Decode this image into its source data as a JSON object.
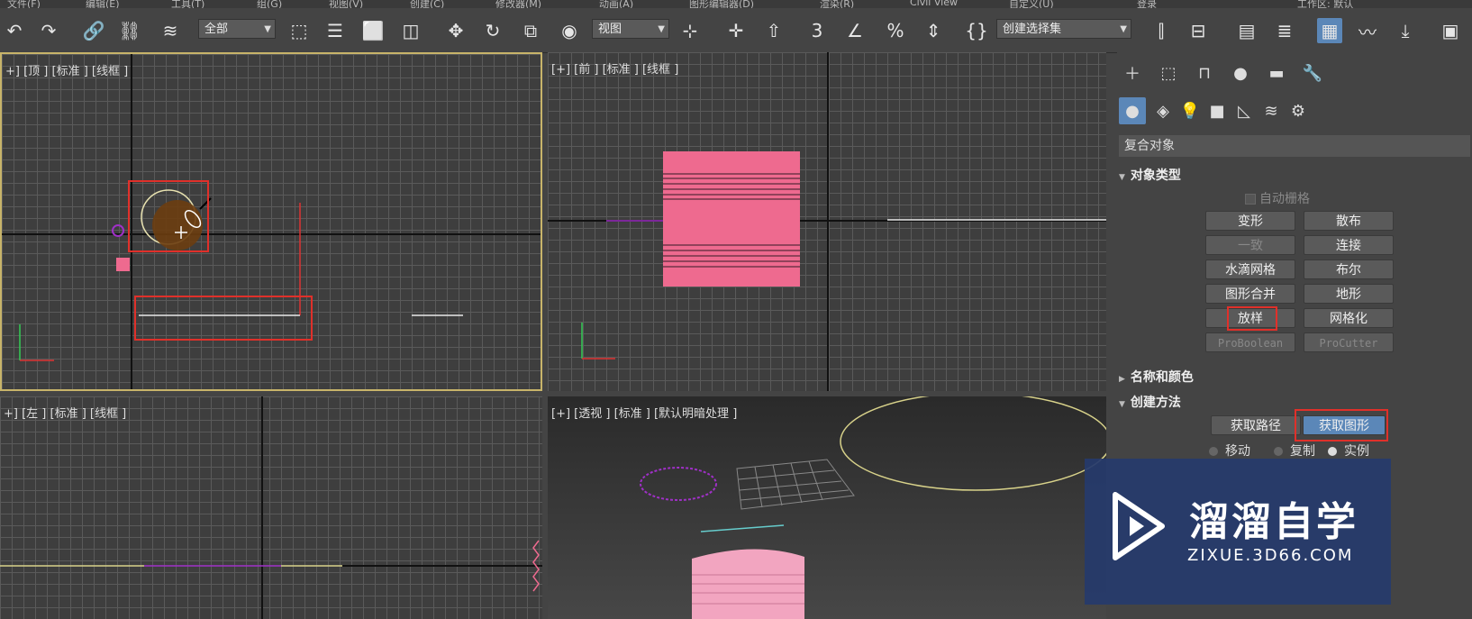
{
  "menubar": {
    "items": [
      "文件(F)",
      "编辑(E)",
      "工具(T)",
      "组(G)",
      "视图(V)",
      "创建(C)",
      "修改器(M)",
      "动画(A)",
      "图形编辑器(D)",
      "渲染(R)",
      "Civil View",
      "自定义(U)"
    ],
    "signin_label": "登录",
    "workspace_label": "工作区: 默认"
  },
  "toolbar": {
    "selection_filter": "全部",
    "ref_coord": "视图",
    "named_selection": "创建选择集",
    "icons": [
      "undo-icon",
      "redo-icon",
      "link-icon",
      "unlink-icon",
      "bind-space-warp-icon",
      "select-object-icon",
      "select-by-name-icon",
      "rect-region-icon",
      "window-crossing-icon",
      "move-icon",
      "rotate-icon",
      "scale-icon",
      "select-and-place-icon",
      "use-pivot-icon",
      "keyboard-shortcut-icon",
      "snap-3-icon",
      "angle-snap-icon",
      "percent-snap-icon",
      "spinner-snap-icon",
      "edit-named-sets-icon",
      "mirror-icon",
      "align-icon",
      "toggle-scene-explorer-icon",
      "toggle-layer-explorer-icon",
      "toggle-ribbon-icon",
      "curve-editor-icon",
      "schematic-view-icon",
      "material-editor-icon"
    ]
  },
  "viewports": {
    "top": {
      "label": "+] [顶 ] [标准 ] [线框 ]"
    },
    "front": {
      "label": "[+] [前 ] [标准 ] [线框 ]"
    },
    "left": {
      "label": "+] [左 ] [标准 ] [线框 ]"
    },
    "persp": {
      "label": "[+] [透视 ] [标准 ] [默认明暗处理 ]"
    }
  },
  "command_panel": {
    "category": "复合对象",
    "rollouts": {
      "object_type": {
        "title": "对象类型",
        "autogrid": "自动栅格",
        "buttons": [
          "变形",
          "散布",
          "一致",
          "连接",
          "水滴网格",
          "布尔",
          "图形合并",
          "地形",
          "放样",
          "网格化",
          "ProBoolean",
          "ProCutter"
        ]
      },
      "name_color": {
        "title": "名称和颜色"
      },
      "creation_method": {
        "title": "创建方法",
        "get_path": "获取路径",
        "get_shape": "获取图形",
        "move": "移动",
        "copy": "复制",
        "instance": "实例"
      }
    }
  },
  "watermark": {
    "name": "溜溜自学",
    "url": "ZIXUE.3D66.COM"
  },
  "colors": {
    "accent_blue": "#5b87b8",
    "highlight_red": "#e0302a",
    "pink_object": "#ee6a8f",
    "active_viewport_border": "#c8b46a"
  }
}
